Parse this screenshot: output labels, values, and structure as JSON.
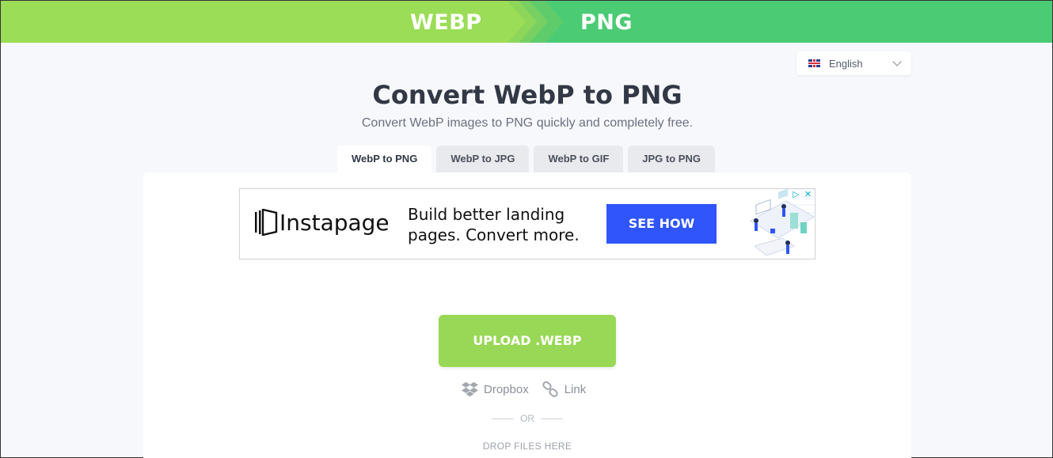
{
  "header": {
    "from_format": "WEBP",
    "to_format": "PNG"
  },
  "language": {
    "selected": "English"
  },
  "page": {
    "title": "Convert WebP to PNG",
    "subtitle": "Convert WebP images to PNG quickly and completely free."
  },
  "tabs": [
    {
      "label": "WebP to PNG",
      "active": true
    },
    {
      "label": "WebP to JPG",
      "active": false
    },
    {
      "label": "WebP to GIF",
      "active": false
    },
    {
      "label": "JPG to PNG",
      "active": false
    }
  ],
  "ad": {
    "brand": "Instapage",
    "headline": "Build better landing pages. Convert more.",
    "cta": "SEE HOW"
  },
  "upload": {
    "button_label": "UPLOAD .WEBP",
    "sources": [
      {
        "label": "Dropbox",
        "icon": "dropbox-icon"
      },
      {
        "label": "Link",
        "icon": "link-icon"
      }
    ],
    "or_label": "OR",
    "drop_label": "DROP FILES HERE"
  },
  "colors": {
    "header_left": "#9bdd56",
    "header_right": "#4bcb74",
    "upload_button": "#99d856",
    "ad_cta": "#2f55fb"
  }
}
